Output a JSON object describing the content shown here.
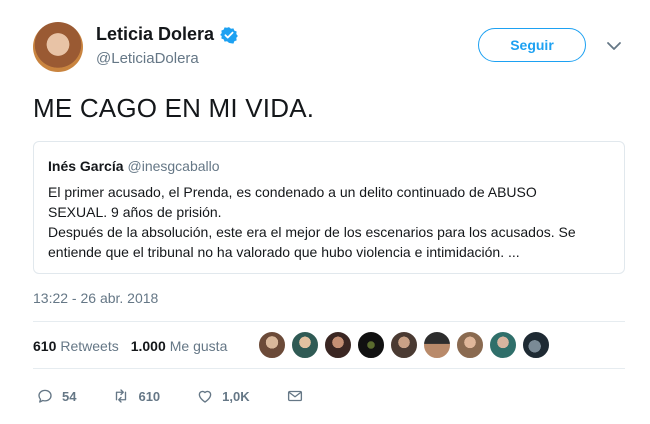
{
  "author": {
    "name": "Leticia Dolera",
    "handle": "@LeticiaDolera",
    "verified_icon": "verified-badge-icon"
  },
  "follow_button": {
    "label": "Seguir"
  },
  "tweet": {
    "text": "ME CAGO EN MI VIDA."
  },
  "quoted_tweet": {
    "name": "Inés García",
    "handle": "@inesgcaballo",
    "lines": [
      "El primer acusado, el Prenda, es condenado a un delito continuado de ABUSO",
      "SEXUAL. 9 años de prisión.",
      "Después de la absolución, este era el mejor de los escenarios para los acusados. Se",
      "entiende que el tribunal no ha valorado que hubo violencia e intimidación. ..."
    ]
  },
  "timestamp": "13:22 - 26 abr. 2018",
  "stats": {
    "retweets_count": "610",
    "retweets_label": "Retweets",
    "likes_count": "1.000",
    "likes_label": "Me gusta"
  },
  "likers_count_visible": 9,
  "actions": {
    "reply_count": "54",
    "retweet_count": "610",
    "like_count": "1,0K"
  },
  "colors": {
    "accent": "#1da1f2",
    "secondary_text": "#657786",
    "border": "#e1e8ed"
  }
}
